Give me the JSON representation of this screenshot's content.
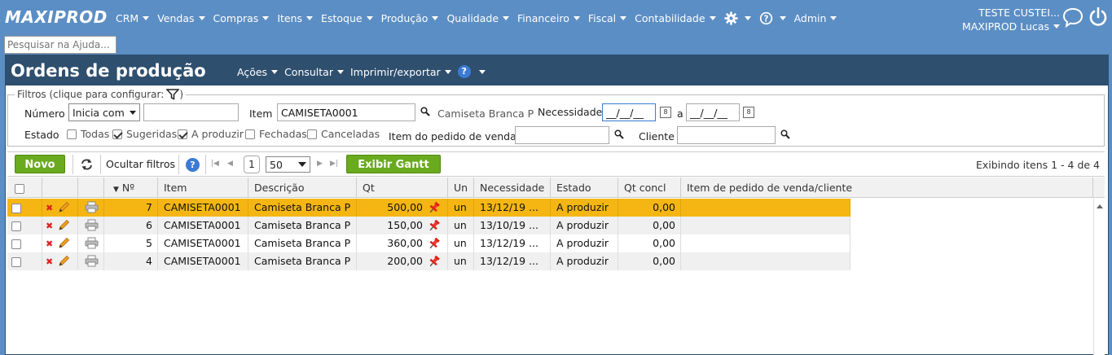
{
  "app": {
    "logo": "MAXIPROD",
    "menu": [
      {
        "label": "CRM"
      },
      {
        "label": "Vendas"
      },
      {
        "label": "Compras"
      },
      {
        "label": "Itens"
      },
      {
        "label": "Estoque"
      },
      {
        "label": "Produção"
      },
      {
        "label": "Qualidade"
      },
      {
        "label": "Financeiro"
      },
      {
        "label": "Fiscal"
      },
      {
        "label": "Contabilidade"
      }
    ],
    "admin_label": "Admin",
    "user_company": "TESTE CUSTEI...",
    "user_name": "MAXIPROD Lucas",
    "help_search_placeholder": "Pesquisar na Ajuda..."
  },
  "page": {
    "title": "Ordens de produção",
    "menu": [
      "Ações",
      "Consultar",
      "Imprimir/exportar"
    ]
  },
  "filters": {
    "legend": "Filtros (clique para configurar:",
    "numero_label": "Número",
    "numero_mode": "Inicia com",
    "numero_value": "",
    "item_label": "Item",
    "item_value": "CAMISETA0001",
    "item_desc": "Camiseta Branca P",
    "necessidade_label": "Necessidade",
    "date_from": "__/__/__",
    "date_sep": "a",
    "date_to": "__/__/__",
    "estado_label": "Estado",
    "states": [
      {
        "label": "Todas",
        "checked": false
      },
      {
        "label": "Sugeridas",
        "checked": true
      },
      {
        "label": "A produzir",
        "checked": true
      },
      {
        "label": "Fechadas",
        "checked": false
      },
      {
        "label": "Canceladas",
        "checked": false
      }
    ],
    "pedido_label": "Item do pedido de venda",
    "pedido_value": "",
    "cliente_label": "Cliente",
    "cliente_value": ""
  },
  "toolbar": {
    "new_label": "Novo",
    "hide_filters_label": "Ocultar filtros",
    "page_number": "1",
    "page_size": "50",
    "gantt_label": "Exibir Gantt",
    "showing": "Exibindo itens 1 - 4 de 4"
  },
  "grid": {
    "columns": [
      "Nº",
      "Item",
      "Descrição",
      "Qt",
      "Un",
      "Necessidade",
      "Estado",
      "Qt concl",
      "Item de pedido de venda/cliente"
    ],
    "rows": [
      {
        "num": "7",
        "item": "CAMISETA0001",
        "desc": "Camiseta Branca P",
        "qt": "500,00",
        "un": "un",
        "nec": "13/12/19 ...",
        "estado": "A produzir",
        "qtconcl": "0,00",
        "pedido": "",
        "selected": true
      },
      {
        "num": "6",
        "item": "CAMISETA0001",
        "desc": "Camiseta Branca P",
        "qt": "150,00",
        "un": "un",
        "nec": "13/10/19 ...",
        "estado": "A produzir",
        "qtconcl": "0,00",
        "pedido": "",
        "selected": false
      },
      {
        "num": "5",
        "item": "CAMISETA0001",
        "desc": "Camiseta Branca P",
        "qt": "360,00",
        "un": "un",
        "nec": "13/12/19 ...",
        "estado": "A produzir",
        "qtconcl": "0,00",
        "pedido": "",
        "selected": false
      },
      {
        "num": "4",
        "item": "CAMISETA0001",
        "desc": "Camiseta Branca P",
        "qt": "200,00",
        "un": "un",
        "nec": "13/12/19 ...",
        "estado": "A produzir",
        "qtconcl": "0,00",
        "pedido": "",
        "selected": false
      }
    ]
  },
  "colors": {
    "header_bg": "#5b8ec4",
    "title_bg": "#2f4f6e",
    "green": "#6aaa1e",
    "selected_row": "#f5b614"
  },
  "icons": [
    "gear-icon",
    "help-icon",
    "chat-icon",
    "power-icon",
    "filter-icon",
    "search-icon",
    "calendar-icon",
    "refresh-icon",
    "delete-icon",
    "edit-icon",
    "print-icon",
    "pin-icon"
  ]
}
